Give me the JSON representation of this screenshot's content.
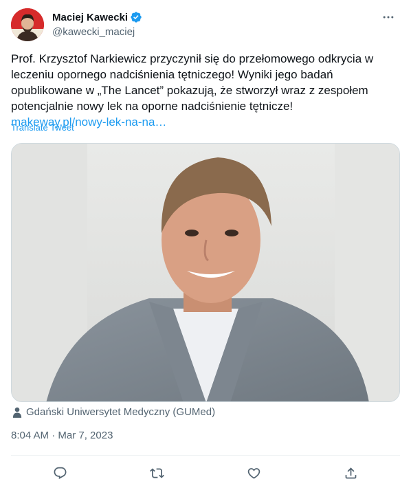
{
  "author": {
    "display_name": "Maciej Kawecki",
    "handle": "@kawecki_maciej",
    "verified": true,
    "avatar_icon": "avatar"
  },
  "tweet": {
    "text": "Prof. Krzysztof Narkiewicz przyczynił się do przełomowego odkrycia w leczeniu opornego nadciśnienia tętniczego! Wyniki jego badań opublikowane w „The Lancet” pokazują, że stworzył wraz z zespołem potencjalnie nowy lek na oporne nadciśnienie tętnicze!",
    "link": "makeway.pl/nowy-lek-na-na…",
    "translate_label": "Translate Tweet",
    "photo_credit": "Gdański Uniwersytet Medyczny (GUMed)",
    "timestamp": "8:04 AM · Mar 7, 2023"
  },
  "icons": {
    "more": "more-icon",
    "verified": "verified-badge-icon",
    "reply": "reply-icon",
    "retweet": "retweet-icon",
    "like": "like-icon",
    "share": "share-icon",
    "credit": "person-icon"
  },
  "colors": {
    "accent": "#1d9bf0",
    "text": "#0f1419",
    "muted": "#536471",
    "border": "#cfd9de"
  }
}
